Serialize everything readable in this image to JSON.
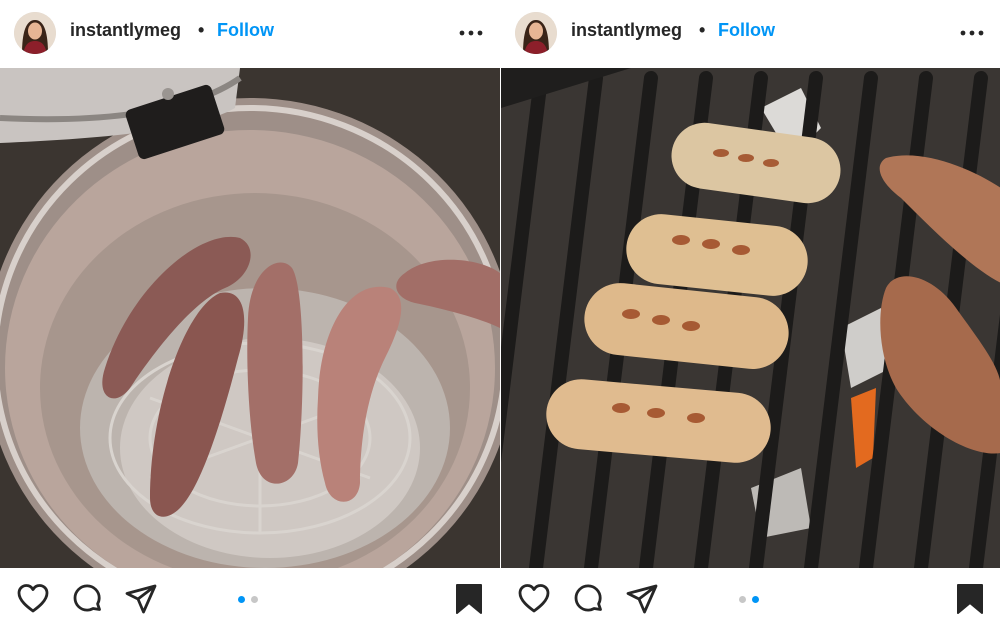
{
  "posts": [
    {
      "username": "instantlymeg",
      "separator": "•",
      "follow_label": "Follow",
      "image_alt": "Raw sausages on a rack inside a pressure cooker pot",
      "carousel_active": 0,
      "carousel_count": 2
    },
    {
      "username": "instantlymeg",
      "separator": "•",
      "follow_label": "Follow",
      "image_alt": "Sausages and meat grilling on a barbecue grate",
      "carousel_active": 1,
      "carousel_count": 2
    }
  ],
  "colors": {
    "follow": "#0095f6",
    "text": "#262626",
    "dot_active": "#0095f6",
    "dot_inactive": "#c7c7c7"
  },
  "icons": [
    "more-icon",
    "heart-icon",
    "comment-icon",
    "share-icon",
    "bookmark-icon"
  ]
}
